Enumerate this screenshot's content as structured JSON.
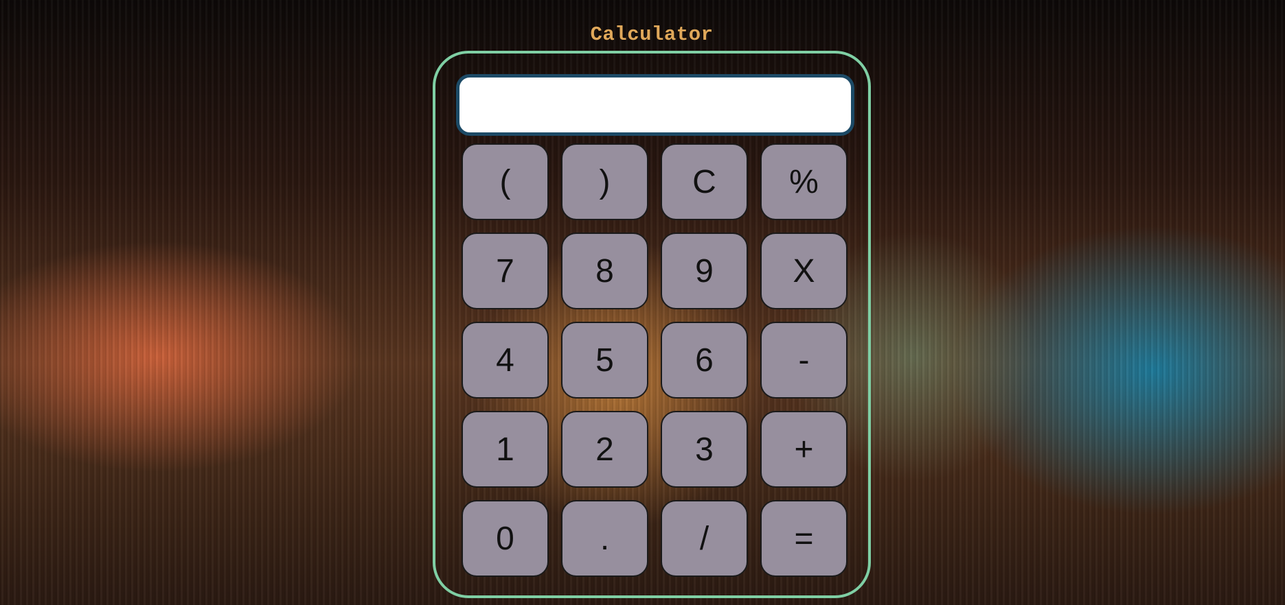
{
  "title": "Calculator",
  "display": {
    "value": ""
  },
  "keys": [
    {
      "label": "(",
      "name": "open-paren-button"
    },
    {
      "label": ")",
      "name": "close-paren-button"
    },
    {
      "label": "C",
      "name": "clear-button"
    },
    {
      "label": "%",
      "name": "percent-button"
    },
    {
      "label": "7",
      "name": "digit-7-button"
    },
    {
      "label": "8",
      "name": "digit-8-button"
    },
    {
      "label": "9",
      "name": "digit-9-button"
    },
    {
      "label": "X",
      "name": "multiply-button"
    },
    {
      "label": "4",
      "name": "digit-4-button"
    },
    {
      "label": "5",
      "name": "digit-5-button"
    },
    {
      "label": "6",
      "name": "digit-6-button"
    },
    {
      "label": "-",
      "name": "subtract-button"
    },
    {
      "label": "1",
      "name": "digit-1-button"
    },
    {
      "label": "2",
      "name": "digit-2-button"
    },
    {
      "label": "3",
      "name": "digit-3-button"
    },
    {
      "label": "+",
      "name": "add-button"
    },
    {
      "label": "0",
      "name": "digit-0-button"
    },
    {
      "label": ".",
      "name": "decimal-point-button"
    },
    {
      "label": "/",
      "name": "divide-button"
    },
    {
      "label": "=",
      "name": "equals-button"
    }
  ],
  "colors": {
    "title": "#e0a85a",
    "frame_border": "#7fcfa4",
    "display_border": "#1c4a66",
    "key_background": "#978f9e"
  }
}
